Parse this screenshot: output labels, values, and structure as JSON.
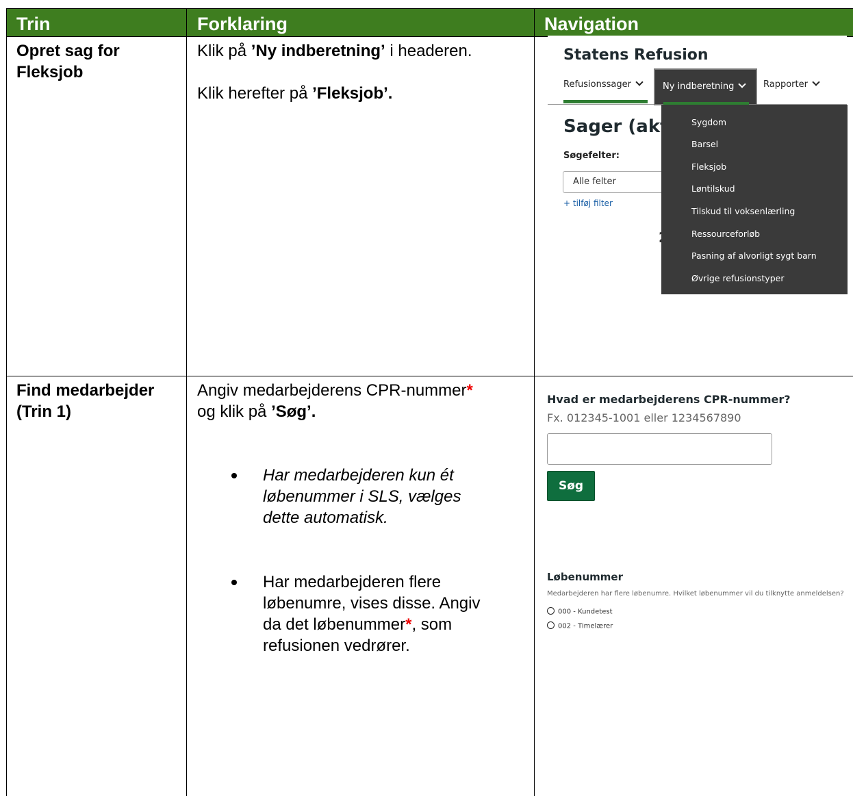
{
  "header": {
    "col1": "Trin",
    "col2": "Forklaring",
    "col3": "Navigation"
  },
  "row1": {
    "step_line1": "Opret sag for",
    "step_line2": "Fleksjob",
    "p1_pre": "Klik på ",
    "p1_bold": "’Ny indberetning’",
    "p1_post": " i headeren.",
    "p2_pre": "Klik herefter på ",
    "p2_bold": "’Fleksjob’."
  },
  "nav1": {
    "title": "Statens Refusion",
    "nav_refusionssager": "Refusionssager",
    "nav_ny_indberetning": "Ny indberetning",
    "nav_rapporter": "Rapporter",
    "heading": "Sager (akt",
    "sogefelter": "Søgefelter:",
    "alle_felter": "Alle felter",
    "tilfoj_filter": "+ tilføj filter",
    "fragment": "2",
    "dropdown": [
      "Sygdom",
      "Barsel",
      "Fleksjob",
      "Løntilskud",
      "Tilskud til voksenlærling",
      "Ressourceforløb",
      "Pasning af alvorligt sygt barn",
      "Øvrige refusionstyper"
    ]
  },
  "row2": {
    "step_line1": "Find medarbejder",
    "step_line2": "(Trin 1)",
    "p1_pre": "Angiv medarbejderens CPR-nummer",
    "star": "*",
    "p1_line2_pre": "og klik på ",
    "p1_line2_bold": "’Søg’.",
    "bullet1_line1": "Har medarbejderen kun ét",
    "bullet1_line2": "løbenummer i SLS, vælges",
    "bullet1_line3": "dette automatisk.",
    "bullet2_line1": "Har medarbejderen flere",
    "bullet2_line2": "løbenumre, vises disse. Angiv",
    "bullet2_line3_pre": "da det løbenummer",
    "bullet2_line3_post": ", som",
    "bullet2_line4": "refusionen vedrører."
  },
  "nav2": {
    "question": "Hvad er medarbejderens CPR-nummer?",
    "hint": "Fx. 012345-1001 eller 1234567890",
    "search_button": "Søg",
    "lobenummer_heading": "Løbenummer",
    "lobenummer_desc": "Medarbejderen har flere løbenumre. Hvilket løbenummer vil du tilknytte anmeldelsen?",
    "options": [
      "000 - Kundetest",
      "002 - Timelærer"
    ]
  }
}
